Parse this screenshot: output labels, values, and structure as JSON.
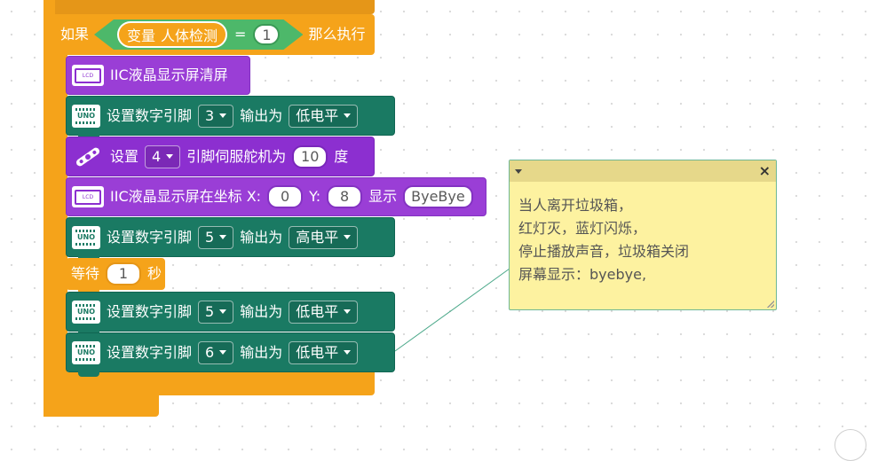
{
  "colors": {
    "workspace_background": "#ffffff",
    "control_orange": "#f5a31a",
    "io_green": "#1a7a63",
    "lcd_purple": "#9a3ed6",
    "servo_violet": "#8c2fd0",
    "logic_green": "#4db86a",
    "comment_yellow": "#fdf2a0"
  },
  "if_block": {
    "if_label": "如果",
    "variable_prefix": "变量",
    "variable_name": "人体检测",
    "operator": "=",
    "compare_value": "1",
    "then_label": "那么执行"
  },
  "blocks": {
    "lcd_clear": {
      "icon": "lcd-icon",
      "label": "IIC液晶显示屏清屏",
      "icon_text": "LCD"
    },
    "digital_write_1": {
      "icon": "uno-board-icon",
      "label": "设置数字引脚",
      "pin": "3",
      "output_label": "输出为",
      "level": "低电平",
      "icon_text": "UNO"
    },
    "servo": {
      "icon": "servo-icon",
      "label": "设置",
      "pin": "4",
      "middle_label": "引脚伺服舵机为",
      "angle": "10",
      "unit": "度"
    },
    "lcd_print": {
      "icon": "lcd-icon",
      "label": "IIC液晶显示屏在坐标 X:",
      "x": "0",
      "y_label": "Y:",
      "y": "8",
      "show_label": "显示",
      "text": "ByeBye",
      "icon_text": "LCD"
    },
    "digital_write_2": {
      "icon": "uno-board-icon",
      "label": "设置数字引脚",
      "pin": "5",
      "output_label": "输出为",
      "level": "高电平",
      "icon_text": "UNO"
    },
    "wait": {
      "label": "等待",
      "seconds": "1",
      "unit": "秒"
    },
    "digital_write_3": {
      "icon": "uno-board-icon",
      "label": "设置数字引脚",
      "pin": "5",
      "output_label": "输出为",
      "level": "低电平",
      "icon_text": "UNO"
    },
    "digital_write_4": {
      "icon": "uno-board-icon",
      "label": "设置数字引脚",
      "pin": "6",
      "output_label": "输出为",
      "level": "低电平",
      "icon_text": "UNO"
    }
  },
  "comment": {
    "collapse_icon": "triangle-down-icon",
    "close_icon": "close-icon",
    "close_symbol": "×",
    "lines": [
      "当人离开垃圾箱，",
      "红灯灭，蓝灯闪烁，",
      "停止播放声音，垃圾箱关闭",
      "屏幕显示：byebye,"
    ]
  }
}
